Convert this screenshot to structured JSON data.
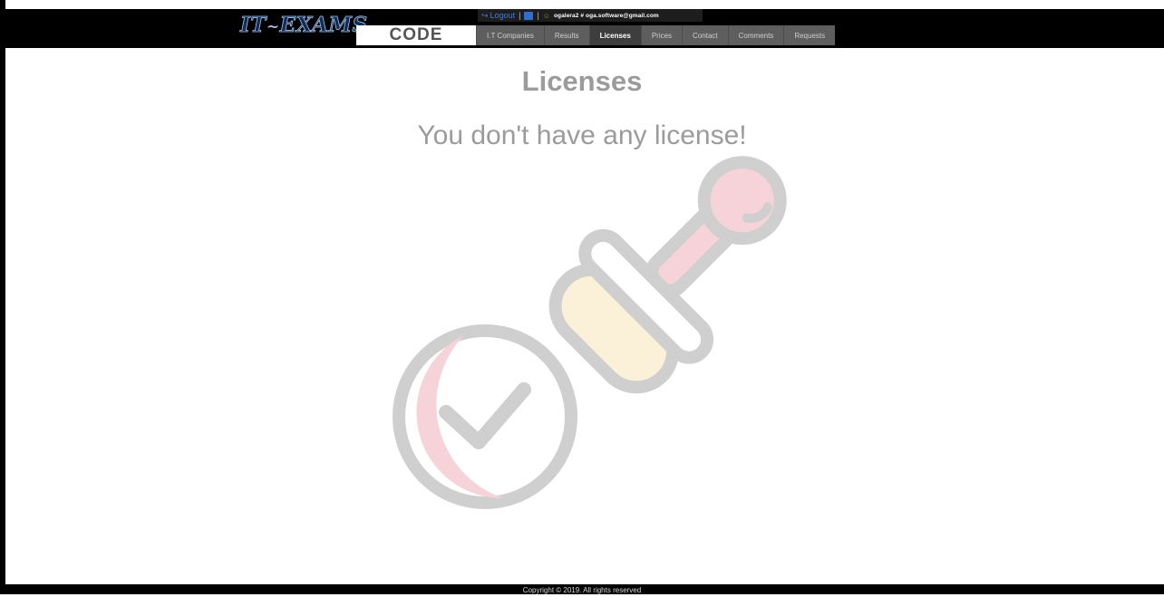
{
  "header": {
    "user_bar": {
      "logout_label": "Logout",
      "separator": "|",
      "cart_icon": "cart-icon",
      "user_icon": "user-icon",
      "user_text": "ogalera2 # oga.software@gmail.com"
    },
    "logo": {
      "left": "IT",
      "tilde": "~",
      "right": "EXAMS"
    },
    "code_label": "CODE",
    "nav": [
      {
        "label": "I.T Companies",
        "active": false
      },
      {
        "label": "Results",
        "active": false
      },
      {
        "label": "Licenses",
        "active": true
      },
      {
        "label": "Prices",
        "active": false
      },
      {
        "label": "Contact",
        "active": false
      },
      {
        "label": "Comments",
        "active": false
      },
      {
        "label": "Requests",
        "active": false
      }
    ]
  },
  "main": {
    "title": "Licenses",
    "message": "You don't have any license!",
    "illustration_icon": "stamp-approved-icon"
  },
  "footer": {
    "copyright": "Copyright © 2019. All rights reserved"
  },
  "colors": {
    "header_bg": "#000000",
    "nav_bg": "#5e5e5e",
    "nav_active_bg": "#3e3e3e",
    "text_gray": "#9b9b9b",
    "illustration_stroke": "#cfcfcf",
    "illustration_pink": "#f6d3d8",
    "illustration_yellow": "#fbf0d8"
  }
}
